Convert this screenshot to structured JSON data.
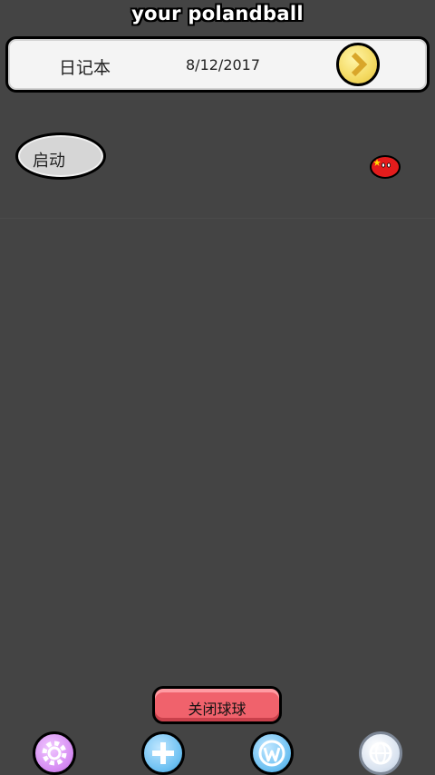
{
  "app": {
    "title": "your polandball"
  },
  "header": {
    "diary_label": "日记本",
    "date": "8/12/2017",
    "next_icon": "chevron-right-icon"
  },
  "main": {
    "start_label": "启动",
    "ball_icon": "china-ball-icon"
  },
  "footer": {
    "close_label": "关闭球球",
    "nav": [
      {
        "icon": "gear-icon",
        "color": "#d68cf3"
      },
      {
        "icon": "plus-icon",
        "color": "#6ec1f2"
      },
      {
        "icon": "wordpress-icon",
        "color": "#6ec1f2"
      },
      {
        "icon": "globe-icon",
        "color": "#d9e3f0"
      }
    ]
  },
  "colors": {
    "background": "#444444",
    "header_bg": "#f4f4f4",
    "close_button": "#f0626c"
  }
}
